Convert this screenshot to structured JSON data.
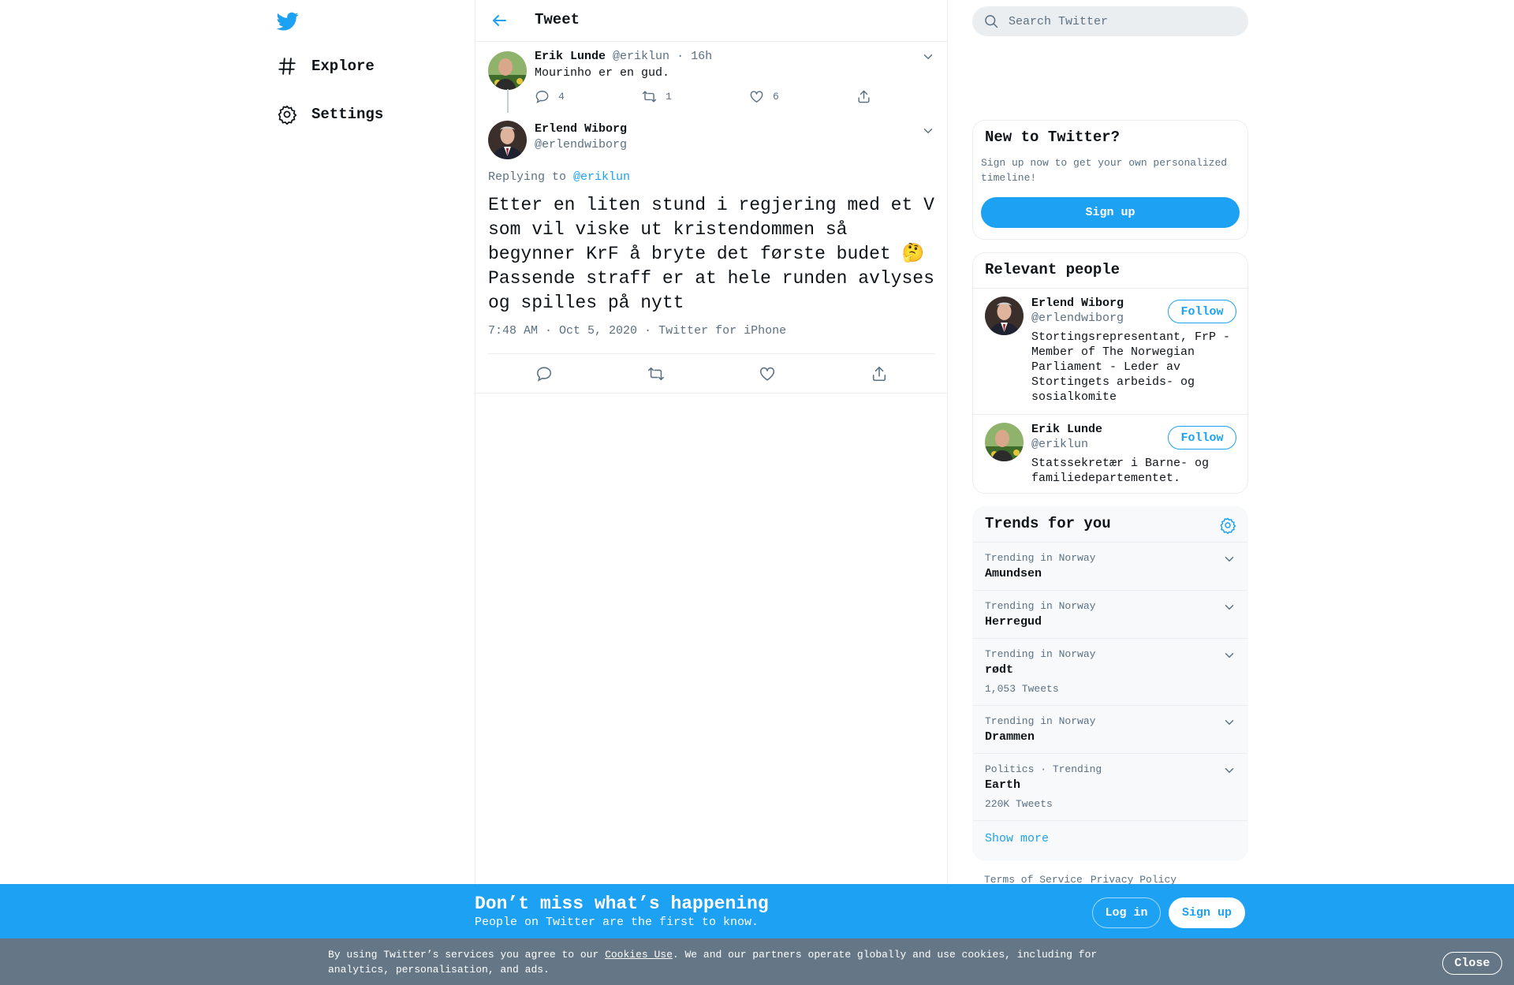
{
  "colors": {
    "accent": "#1da1f2",
    "text": "#0f1419",
    "muted": "#5b7083",
    "cookie_bar": "#657786"
  },
  "nav": {
    "logo_icon": "twitter-bird-icon",
    "items": [
      {
        "label": "Explore",
        "icon": "hashtag-icon"
      },
      {
        "label": "Settings",
        "icon": "gear-icon"
      }
    ]
  },
  "header": {
    "title": "Tweet",
    "back_icon": "back-arrow-icon"
  },
  "parent_tweet": {
    "name": "Erik Lunde",
    "handle": "@eriklun",
    "time": "16h",
    "text": "Mourinho er en gud.",
    "replies": "4",
    "retweets": "1",
    "likes": "6"
  },
  "focus_tweet": {
    "name": "Erlend Wiborg",
    "handle": "@erlendwiborg",
    "replying_to_label": "Replying to",
    "replying_to_handle": "@eriklun",
    "text": "Etter en liten stund i regjering med et V som vil viske ut kristendommen så begynner KrF å bryte det første budet 🤔 Passende straff er at hele runden avlyses og spilles på nytt",
    "timestamp": "7:48 AM · Oct 5, 2020",
    "source": "Twitter for iPhone"
  },
  "search": {
    "placeholder": "Search Twitter"
  },
  "new_to_twitter": {
    "title": "New to Twitter?",
    "subtitle": "Sign up now to get your own personalized timeline!",
    "button": "Sign up"
  },
  "relevant_people": {
    "title": "Relevant people",
    "people": [
      {
        "name": "Erlend Wiborg",
        "handle": "@erlendwiborg",
        "bio": "Stortingsrepresentant, FrP - Member of The Norwegian Parliament - Leder av Stortingets arbeids- og sosialkomite",
        "button": "Follow"
      },
      {
        "name": "Erik Lunde",
        "handle": "@eriklun",
        "bio": "Statssekretær i Barne- og familiedepartementet.",
        "button": "Follow"
      }
    ]
  },
  "trends": {
    "title": "Trends for you",
    "items": [
      {
        "context": "Trending in Norway",
        "name": "Amundsen",
        "count": ""
      },
      {
        "context": "Trending in Norway",
        "name": "Herregud",
        "count": ""
      },
      {
        "context": "Trending in Norway",
        "name": "rødt",
        "count": "1,053 Tweets"
      },
      {
        "context": "Trending in Norway",
        "name": "Drammen",
        "count": ""
      },
      {
        "context": "Politics · Trending",
        "name": "Earth",
        "count": "220K Tweets"
      }
    ],
    "show_more": "Show more"
  },
  "footer": {
    "links": [
      "Terms of Service",
      "Privacy Policy"
    ]
  },
  "bottom_bar": {
    "title": "Don’t miss what’s happening",
    "subtitle": "People on Twitter are the first to know.",
    "login": "Log in",
    "signup": "Sign up"
  },
  "cookie_bar": {
    "text_before": "By using Twitter’s services you agree to our ",
    "link": "Cookies Use",
    "text_after": ". We and our partners operate globally and use cookies, including for analytics, personalisation, and ads.",
    "close": "Close"
  }
}
